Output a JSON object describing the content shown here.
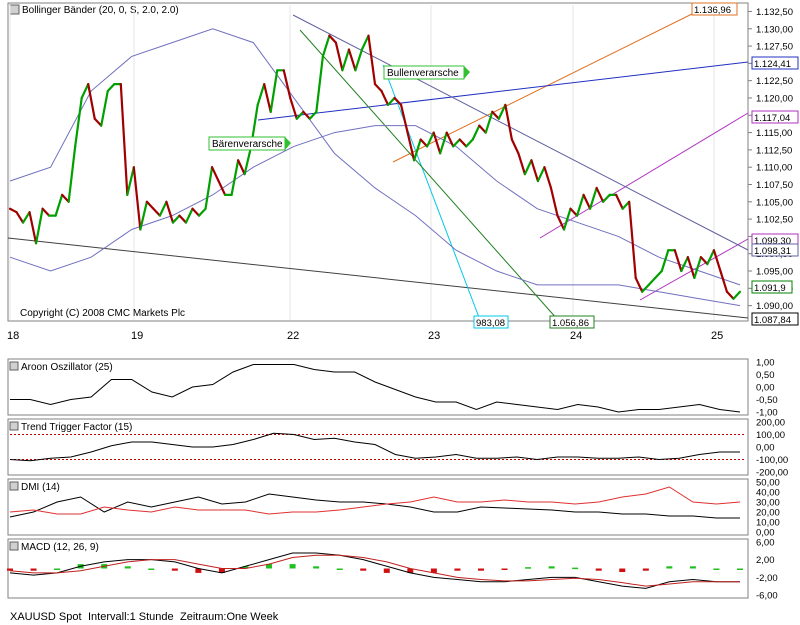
{
  "main": {
    "indicator_label": "Bollinger Bänder (20, 0, S, 2.0, 2.0)",
    "copyright": "Copyright (C) 2008 CMC Markets Plc",
    "annotations": [
      {
        "id": "baerenverarsche",
        "text": "Bärenverarsche"
      },
      {
        "id": "bullenverarsche",
        "text": "Bullenverarsche"
      }
    ],
    "price_ticks": [
      "1.132,50",
      "1.130,00",
      "1.127,50",
      "1.125,00",
      "1.122,50",
      "1.120,00",
      "1.117,50",
      "1.115,00",
      "1.112,50",
      "1.110,00",
      "1.107,50",
      "1.105,00",
      "1.102,50",
      "1.100,00",
      "1.097,50",
      "1.095,00",
      "1.092,50",
      "1.090,00"
    ],
    "date_ticks": [
      "18",
      "19",
      "22",
      "23",
      "24",
      "25"
    ],
    "price_tags": [
      {
        "id": "tag-1136",
        "text": "1.136,96",
        "color": "#e07020"
      },
      {
        "id": "tag-1124",
        "text": "1.124,41",
        "color": "#2030c0"
      },
      {
        "id": "tag-1117",
        "text": "1.117,04",
        "color": "#b030c0"
      },
      {
        "id": "tag-1099",
        "text": "1.099,30",
        "color": "#b030c0"
      },
      {
        "id": "tag-1098",
        "text": "1.098,31",
        "color": "#6060a0"
      },
      {
        "id": "tag-1091",
        "text": "1.091,9",
        "color": "#008000"
      },
      {
        "id": "tag-1087",
        "text": "1.087,84",
        "color": "#000000"
      },
      {
        "id": "tag-983",
        "text": "983,08",
        "color": "#00c8e8"
      },
      {
        "id": "tag-1056",
        "text": "1.056,86",
        "color": "#208020"
      }
    ]
  },
  "panels": {
    "aroon": {
      "label": "Aroon Oszillator (25)",
      "ticks": [
        "1,00",
        "0,50",
        "0,00",
        "-0,50",
        "-1,00"
      ]
    },
    "ttf": {
      "label": "Trend Trigger Factor (15)",
      "ticks": [
        "200,00",
        "100,00",
        "0,00",
        "-100,00",
        "-200,00"
      ]
    },
    "dmi": {
      "label": "DMI (14)",
      "ticks": [
        "50,00",
        "40,00",
        "30,00",
        "20,00",
        "10,00",
        "0,00"
      ]
    },
    "macd": {
      "label": "MACD (12, 26, 9)",
      "ticks": [
        "6,00",
        "2,00",
        "-2,00",
        "-6,00"
      ]
    }
  },
  "footer": {
    "symbol": "XAUUSD Spot",
    "interval": "Intervall:1 Stunde",
    "range": "Zeitraum:One Week"
  },
  "colors": {
    "up": "#00a000",
    "down": "#a00000",
    "bands": "#7070c0",
    "panel_border": "#808080"
  },
  "chart_data": [
    {
      "type": "line",
      "title": "Bollinger Bänder (20, 0, S, 2.0, 2.0)",
      "xlabel": "",
      "ylabel": "",
      "x_ticks": [
        "18",
        "19",
        "22",
        "23",
        "24",
        "25"
      ],
      "ylim": [
        1088.5,
        1133
      ],
      "series": [
        {
          "values": [
            1104,
            1103.5,
            1102,
            1103.5,
            1099,
            1104,
            1103,
            1103,
            1106,
            1105,
            1113,
            1120,
            1122,
            1117,
            1116,
            1121,
            1122,
            1122,
            1106,
            1110,
            1101,
            1105,
            1104,
            1103,
            1105,
            1102,
            1103,
            1102,
            1104,
            1103,
            1104,
            1110,
            1108,
            1106,
            1106,
            1111,
            1109,
            1113,
            1119,
            1122,
            1118,
            1124,
            1124,
            1120,
            1117,
            1118,
            1117,
            1118,
            1126,
            1129,
            1128,
            1124,
            1127,
            1124,
            1127,
            1129,
            1122,
            1121,
            1119,
            1120,
            1119,
            1115,
            1111,
            1114,
            1113,
            1115,
            1112,
            1115,
            1113,
            1114,
            1113,
            1114,
            1116,
            1115,
            1118,
            1117,
            1119,
            1114,
            1112,
            1109,
            1111,
            1108,
            1110,
            1107,
            1103,
            1101,
            1104,
            1103,
            1106,
            1104,
            1107,
            1105,
            1106,
            1106,
            1104,
            1105,
            1094,
            1092,
            1093,
            1094,
            1095,
            1098,
            1098,
            1095,
            1097,
            1094,
            1097,
            1096,
            1098,
            1095,
            1092,
            1091,
            1092
          ]
        },
        {
          "name": "",
          "values": [
            1108,
            1110,
            1121,
            1126,
            1128,
            1130,
            1128,
            1120,
            1112,
            1107,
            1103,
            1098,
            1095,
            1093,
            1093,
            1093,
            1092,
            1091,
            1090
          ]
        },
        {
          "name": "",
          "values": [
            1097,
            1095,
            1097,
            1101,
            1103,
            1106,
            1110,
            1113,
            1115,
            1116,
            1116,
            1113,
            1108,
            1104,
            1102,
            1100,
            1097,
            1095,
            1093
          ]
        }
      ]
    },
    {
      "type": "line",
      "title": "Aroon Oszillator (25)",
      "ylim": [
        -1,
        1
      ],
      "series": [
        {
          "values": [
            -0.5,
            -0.5,
            -0.7,
            -0.5,
            -0.4,
            0.3,
            0.3,
            -0.2,
            -0.4,
            0,
            0.1,
            0.6,
            0.9,
            0.9,
            0.9,
            0.7,
            0.6,
            0.6,
            0.2,
            -0.1,
            -0.4,
            -0.6,
            -0.6,
            -0.9,
            -0.6,
            -0.7,
            -0.8,
            -0.9,
            -0.7,
            -0.8,
            -1,
            -0.9,
            -0.9,
            -0.8,
            -0.7,
            -0.9,
            -1
          ]
        }
      ]
    },
    {
      "type": "line",
      "title": "Trend Trigger Factor (15)",
      "ylim": [
        -200,
        200
      ],
      "series": [
        {
          "values": [
            -100,
            -110,
            -90,
            -80,
            -40,
            10,
            40,
            40,
            20,
            0,
            0,
            20,
            60,
            110,
            100,
            60,
            70,
            40,
            20,
            -60,
            -90,
            -80,
            -60,
            -90,
            -90,
            -80,
            -100,
            -80,
            -80,
            -90,
            -90,
            -80,
            -100,
            -90,
            -60,
            -40,
            -40
          ]
        }
      ]
    },
    {
      "type": "line",
      "title": "DMI (14)",
      "ylim": [
        0,
        50
      ],
      "series": [
        {
          "values": [
            15,
            20,
            30,
            35,
            20,
            30,
            25,
            30,
            35,
            28,
            30,
            38,
            35,
            32,
            30,
            30,
            28,
            25,
            20,
            20,
            25,
            24,
            23,
            22,
            20,
            20,
            18,
            18,
            16,
            16,
            14,
            14
          ]
        },
        {
          "values": [
            20,
            22,
            18,
            18,
            25,
            22,
            20,
            25,
            22,
            22,
            22,
            18,
            20,
            20,
            22,
            25,
            28,
            30,
            35,
            30,
            30,
            32,
            30,
            30,
            28,
            30,
            35,
            38,
            45,
            30,
            28,
            30
          ]
        }
      ]
    },
    {
      "type": "line",
      "title": "MACD (12, 26, 9)",
      "ylim": [
        -6,
        6
      ],
      "series": [
        {
          "values": [
            -1,
            -1.5,
            -1,
            0.5,
            1.5,
            2,
            2,
            1.5,
            0,
            -1,
            0.5,
            2,
            3.5,
            3.5,
            3,
            2,
            0.5,
            -1,
            -2,
            -2.5,
            -3,
            -3,
            -2.5,
            -2,
            -2,
            -3,
            -4,
            -4.5,
            -3,
            -2.5,
            -3,
            -3
          ]
        },
        {
          "values": [
            -0.5,
            -1,
            -1,
            -0.5,
            0.5,
            1.5,
            2,
            2,
            1,
            0,
            0,
            1,
            2.5,
            3,
            3,
            2.5,
            1.5,
            0,
            -1,
            -2,
            -2.5,
            -2.8,
            -2.8,
            -2.5,
            -2.2,
            -2.5,
            -3.2,
            -4,
            -3.5,
            -3,
            -3,
            -3
          ]
        }
      ]
    }
  ]
}
